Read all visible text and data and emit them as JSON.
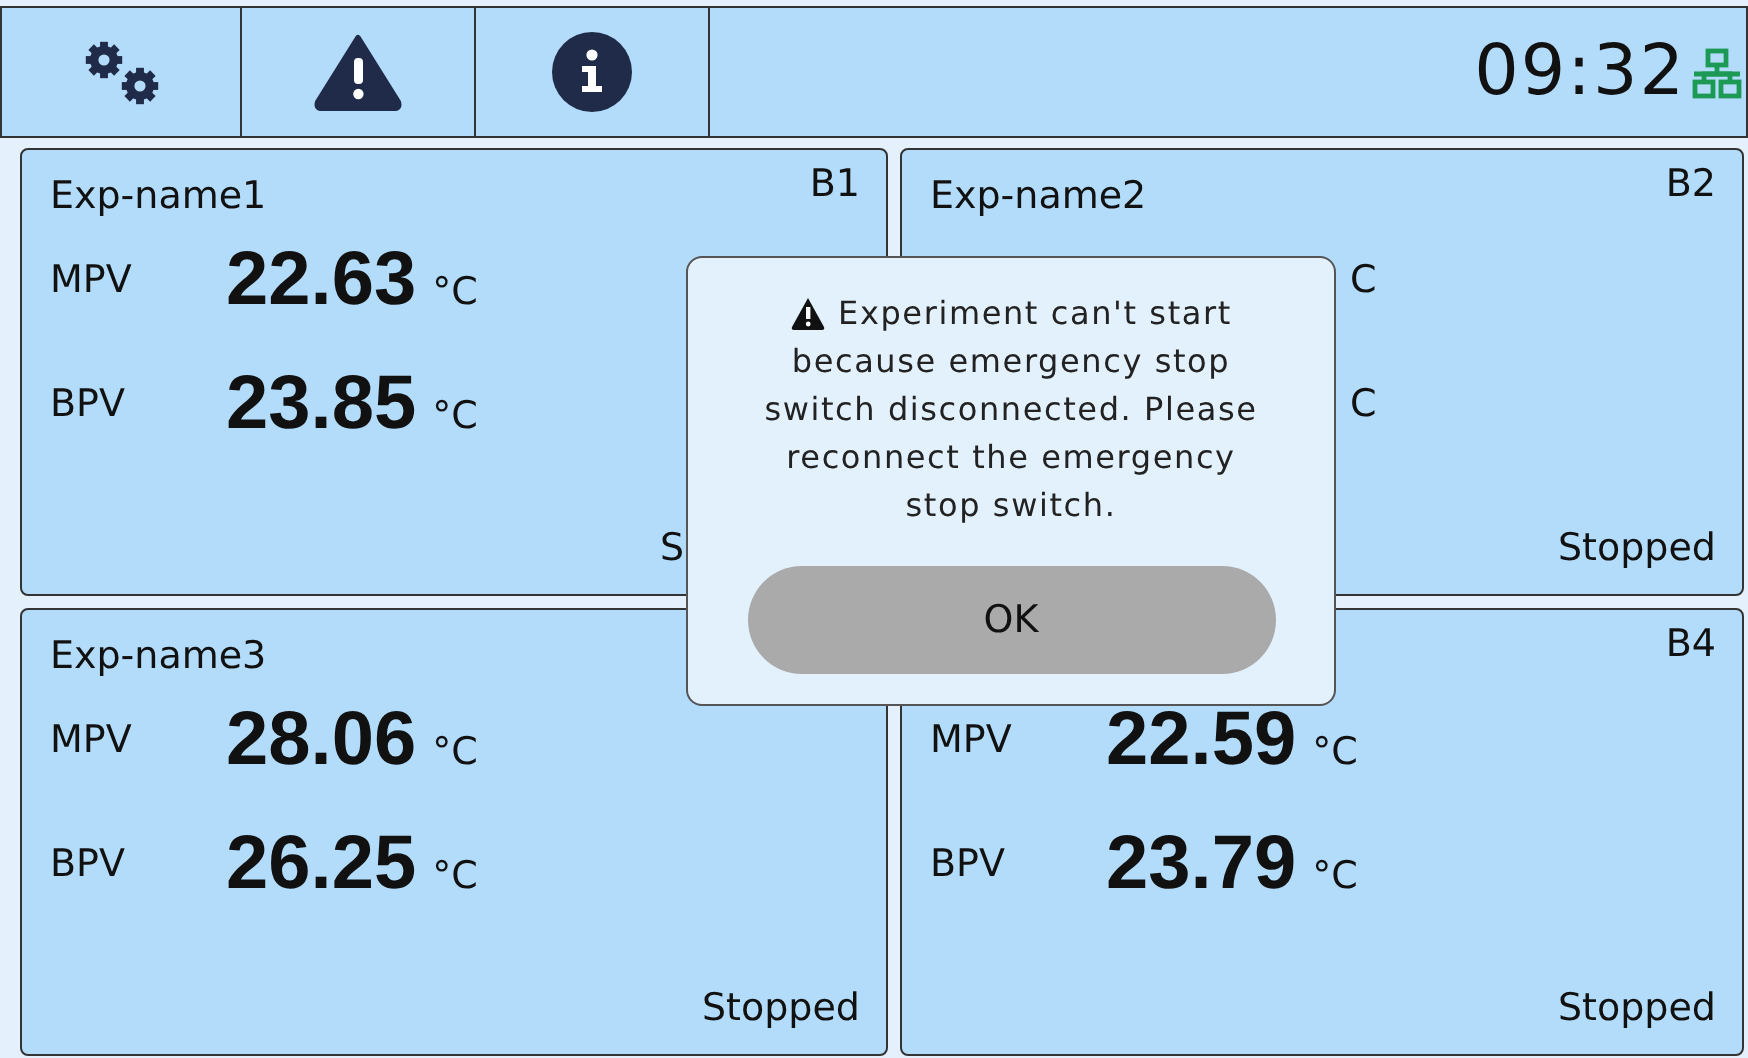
{
  "toolbar": {
    "buttons": [
      {
        "kind": "settings"
      },
      {
        "kind": "warning"
      },
      {
        "kind": "info"
      }
    ],
    "time": "09:32"
  },
  "cards": [
    {
      "name": "Exp-name1",
      "slot": "B1",
      "readings": [
        {
          "label": "MPV",
          "value": "22.63",
          "unit": "°C"
        },
        {
          "label": "BPV",
          "value": "23.85",
          "unit": "°C"
        }
      ],
      "status": "S"
    },
    {
      "name": "Exp-name2",
      "slot": "B2",
      "readings": [
        {
          "unit": "C"
        },
        {
          "unit": "C"
        }
      ],
      "status": "Stopped"
    },
    {
      "name": "Exp-name3",
      "readings": [
        {
          "label": "MPV",
          "value": "28.06",
          "unit": "°C"
        },
        {
          "label": "BPV",
          "value": "26.25",
          "unit": "°C"
        }
      ],
      "status": "Stopped"
    },
    {
      "slot": "B4",
      "readings": [
        {
          "label": "MPV",
          "value": "22.59",
          "unit": "°C"
        },
        {
          "label": "BPV",
          "value": "23.79",
          "unit": "°C"
        }
      ],
      "status": "Stopped"
    }
  ],
  "dialog": {
    "title": "Experiment can't start",
    "message": "because emergency stop switch disconnected. Please reconnect the emergency stop switch.",
    "button": "OK"
  }
}
